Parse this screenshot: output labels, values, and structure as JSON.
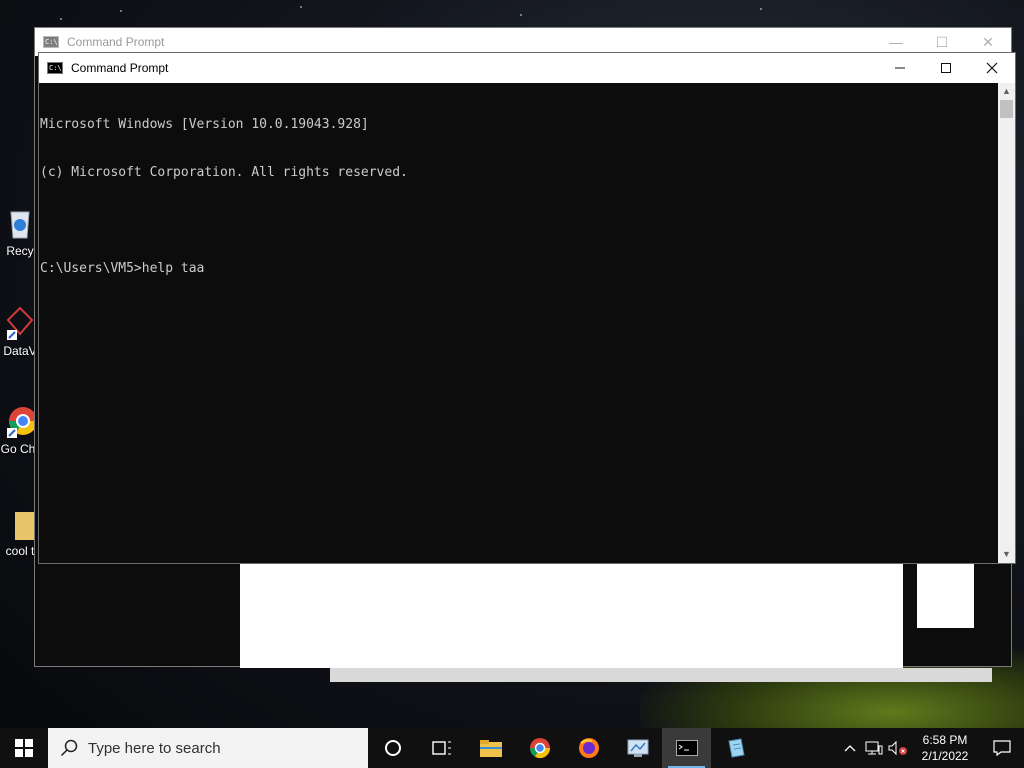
{
  "desktop": {
    "icons": [
      {
        "label": "Recy"
      },
      {
        "label": "DataV"
      },
      {
        "label": "Go Chr"
      },
      {
        "label": "cool t"
      }
    ]
  },
  "back_window": {
    "title": "Command Prompt"
  },
  "front_window": {
    "title": "Command Prompt",
    "console_lines": [
      "Microsoft Windows [Version 10.0.19043.928]",
      "(c) Microsoft Corporation. All rights reserved.",
      "",
      "C:\\Users\\VM5>help taa"
    ]
  },
  "taskbar": {
    "search_placeholder": "Type here to search",
    "apps": [
      "cortana-icon",
      "task-view-icon",
      "file-explorer-icon",
      "chrome-icon",
      "firefox-icon",
      "control-panel-icon",
      "command-prompt-icon",
      "notepad-icon"
    ],
    "active_app": "command-prompt-icon",
    "time": "6:58 PM",
    "date": "2/1/2022"
  },
  "colors": {
    "console_bg": "#0c0c0c",
    "console_text": "#cccccc",
    "taskbar_bg": "#101010",
    "accent": "#77b6ea"
  }
}
